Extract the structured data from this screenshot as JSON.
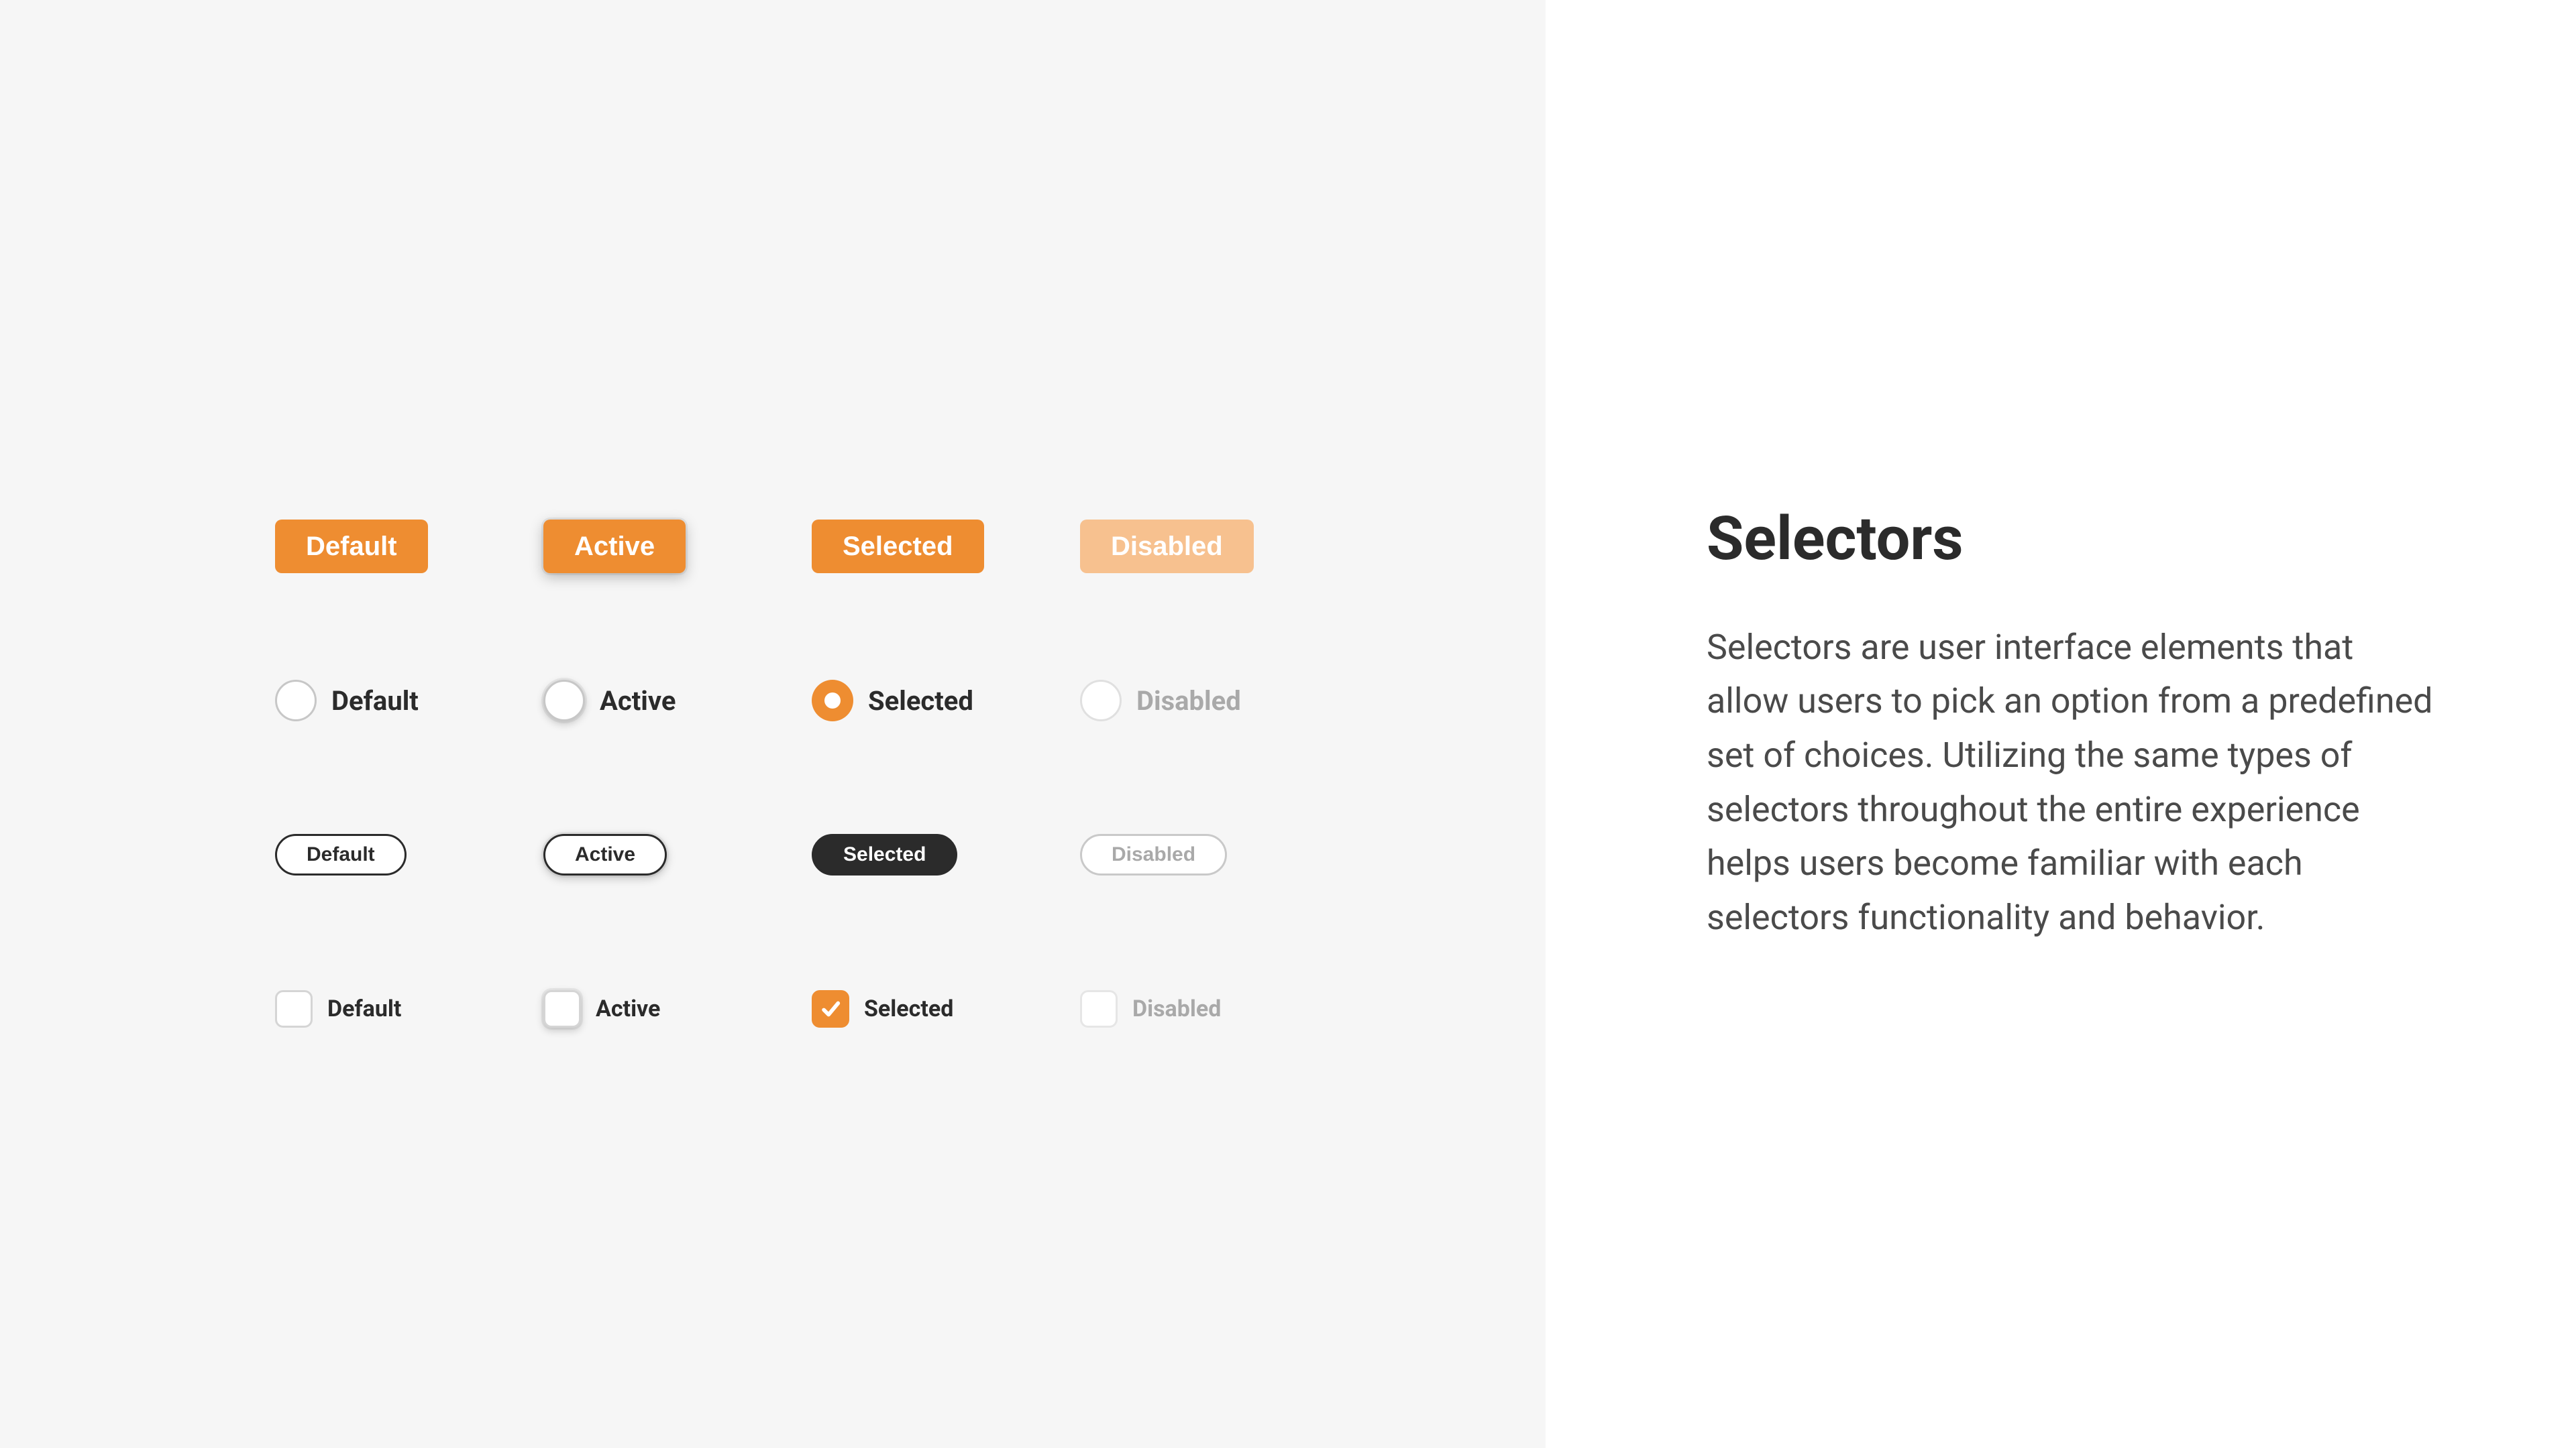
{
  "right": {
    "heading": "Selectors",
    "body": "Selectors are user interface elements that allow users to pick an option from a predefined set of choices. Utilizing the same types of selectors throughout the entire experience helps users become familiar with each selectors functionality and behavior."
  },
  "states": {
    "default": "Default",
    "active": "Active",
    "selected": "Selected",
    "disabled": "Disabled"
  },
  "colors": {
    "accent": "#ee8d31",
    "dark": "#2b2b2b",
    "muted": "#a9a9a9"
  }
}
